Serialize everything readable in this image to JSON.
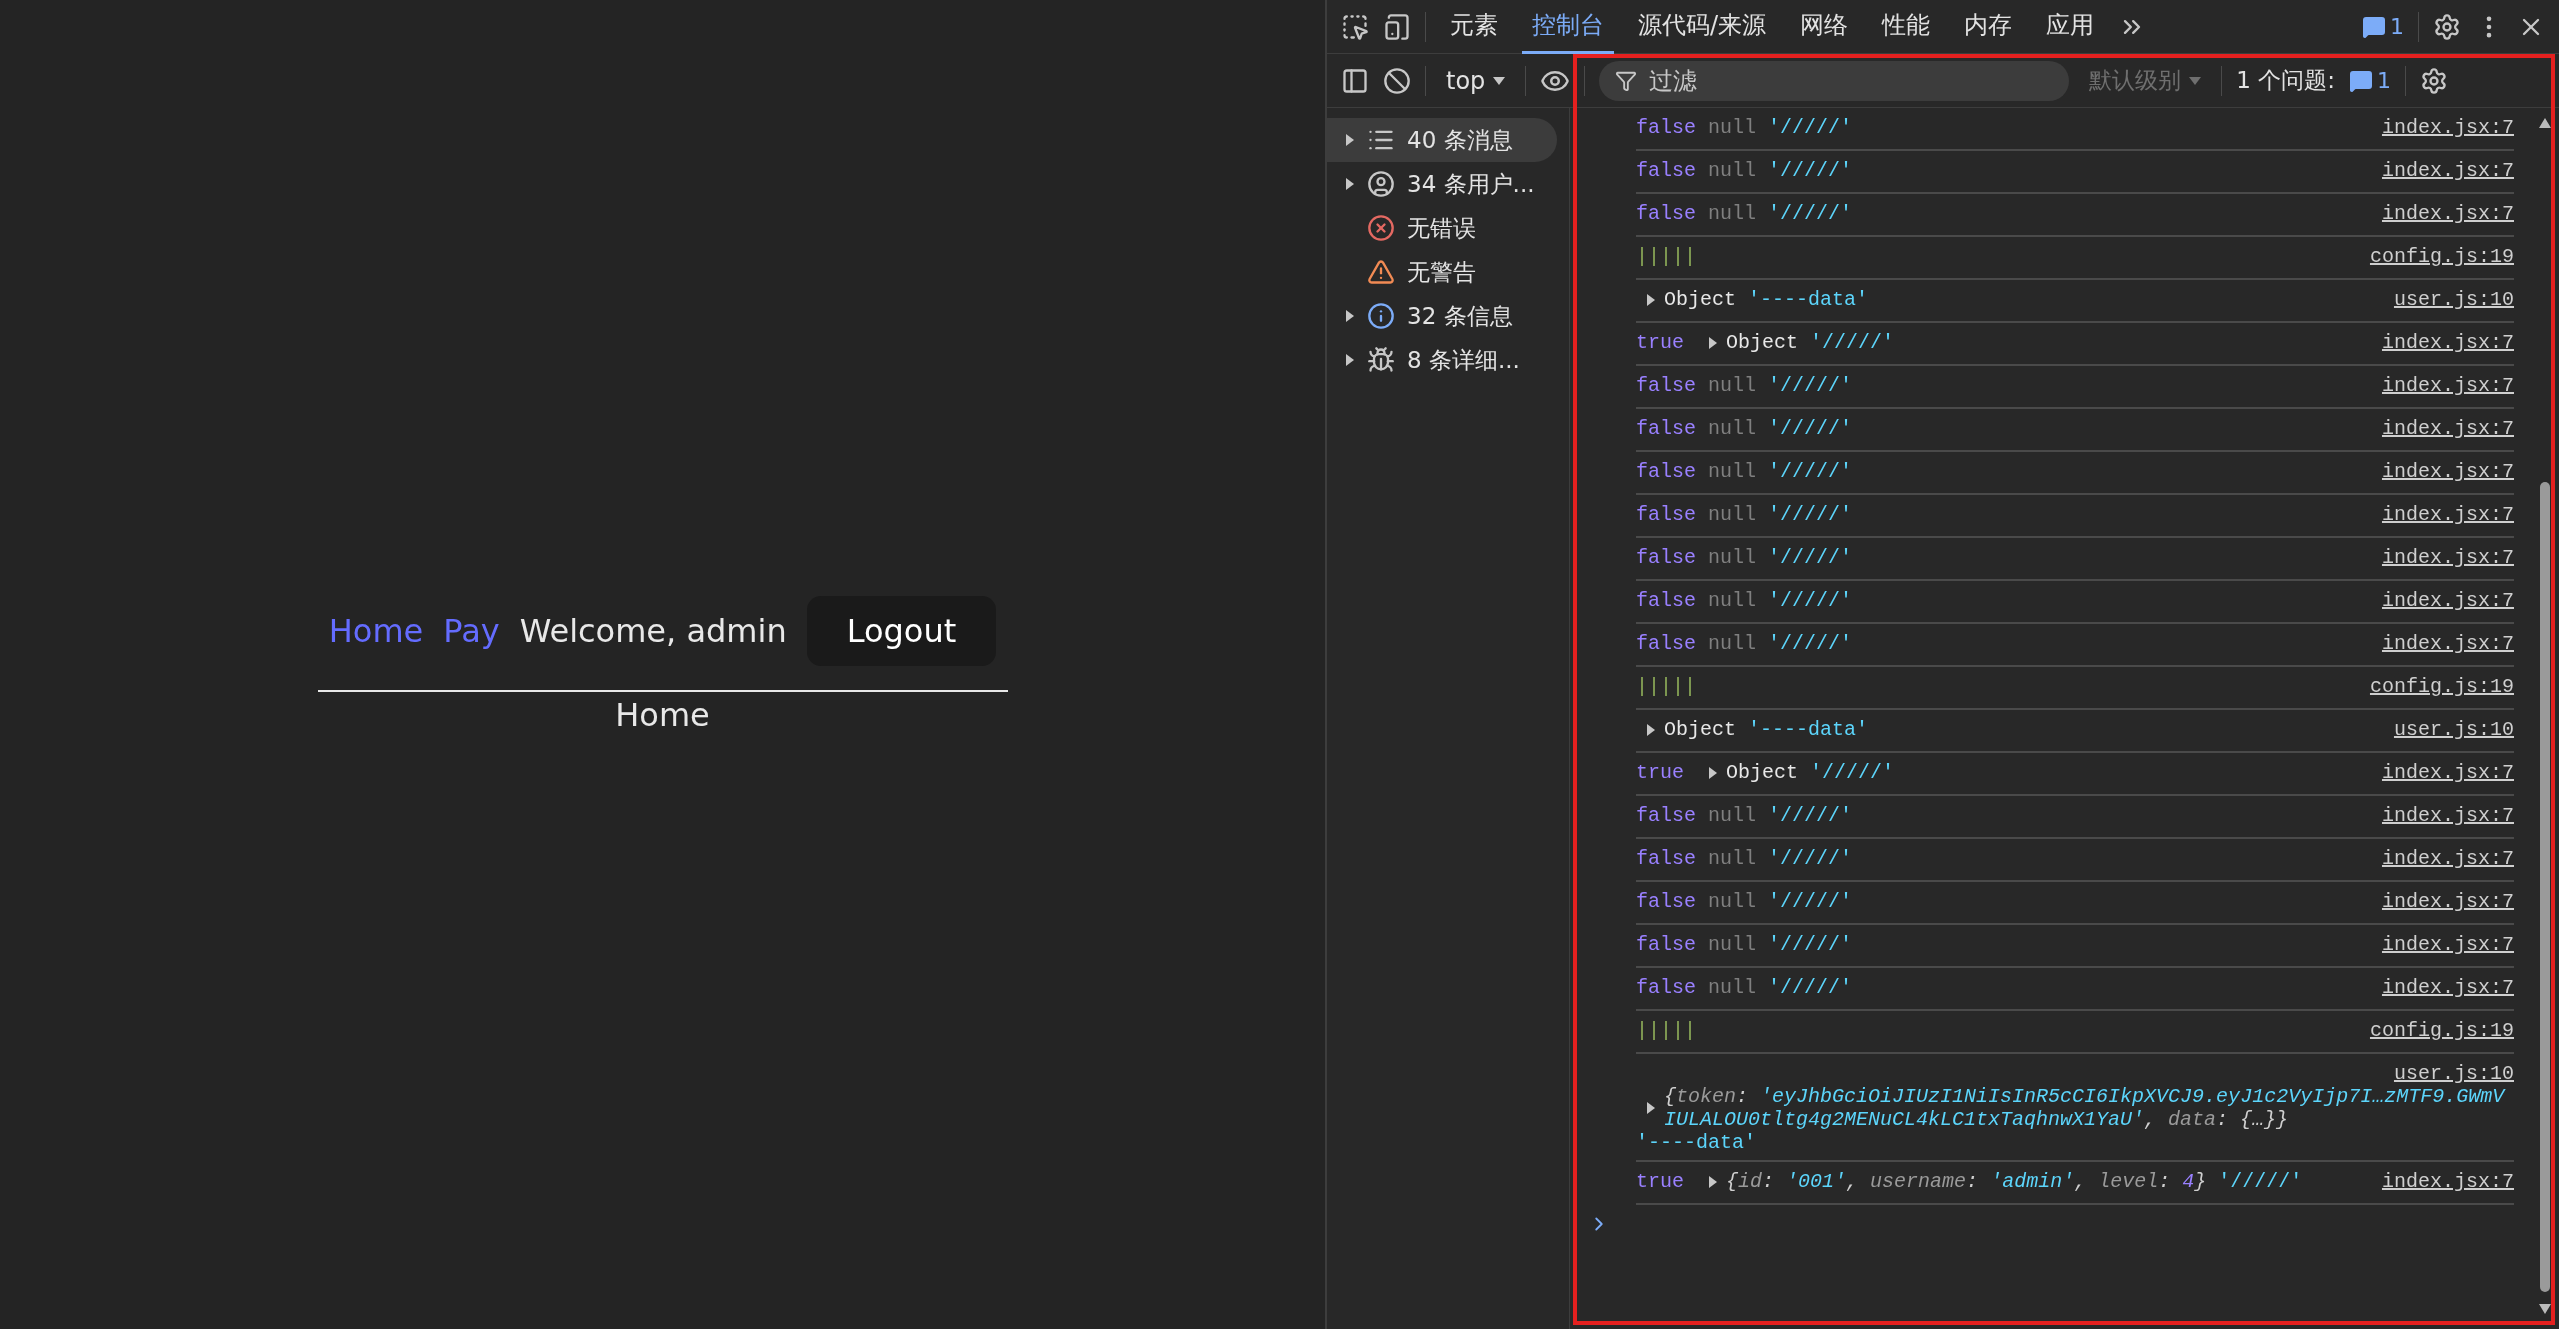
{
  "app": {
    "nav_links": [
      {
        "label": "Home"
      },
      {
        "label": "Pay"
      }
    ],
    "greeting": "Welcome, admin",
    "logout_button": "Logout",
    "page_heading": "Home"
  },
  "devtools": {
    "tabs": [
      {
        "label": "元素",
        "selected": false
      },
      {
        "label": "控制台",
        "selected": true
      },
      {
        "label": "源代码/来源",
        "selected": false
      },
      {
        "label": "网络",
        "selected": false
      },
      {
        "label": "性能",
        "selected": false
      },
      {
        "label": "内存",
        "selected": false
      },
      {
        "label": "应用",
        "selected": false
      }
    ],
    "issue_count": "1",
    "console_toolbar": {
      "context": "top",
      "filter_placeholder": "过滤",
      "level": {
        "label": "默认级别",
        "disabled": true
      },
      "issues_label": "1 个问题:",
      "issues_count": "1"
    },
    "sidebar": [
      {
        "label": "40 条消息",
        "kind": "list",
        "expandable": true,
        "selected": true
      },
      {
        "label": "34 条用户...",
        "kind": "user",
        "expandable": true,
        "selected": false
      },
      {
        "label": "无错误",
        "kind": "error",
        "expandable": false,
        "selected": false
      },
      {
        "label": "无警告",
        "kind": "warning",
        "expandable": false,
        "selected": false
      },
      {
        "label": "32 条信息",
        "kind": "info",
        "expandable": true,
        "selected": false
      },
      {
        "label": "8 条详细...",
        "kind": "verbose",
        "expandable": true,
        "selected": false
      }
    ],
    "messages": [
      {
        "kind": "inline",
        "parts": [
          {
            "kind": "boolean",
            "text": "false"
          },
          {
            "kind": "null",
            "text": "null"
          },
          {
            "kind": "string",
            "text": "'/////'"
          }
        ],
        "source": "index.jsx:7"
      },
      {
        "kind": "inline",
        "parts": [
          {
            "kind": "boolean",
            "text": "false"
          },
          {
            "kind": "null",
            "text": "null"
          },
          {
            "kind": "string",
            "text": "'/////'"
          }
        ],
        "source": "index.jsx:7"
      },
      {
        "kind": "inline",
        "parts": [
          {
            "kind": "boolean",
            "text": "false"
          },
          {
            "kind": "null",
            "text": "null"
          },
          {
            "kind": "string",
            "text": "'/////'"
          }
        ],
        "source": "index.jsx:7"
      },
      {
        "kind": "inline",
        "parts": [
          {
            "kind": "bars",
            "text": "|||||"
          }
        ],
        "source": "config.js:19"
      },
      {
        "kind": "inline",
        "parts": [
          {
            "kind": "object",
            "text": "Object"
          },
          {
            "kind": "string",
            "text": "'----data'"
          }
        ],
        "source": "user.js:10"
      },
      {
        "kind": "inline",
        "parts": [
          {
            "kind": "boolean",
            "text": "true"
          },
          {
            "kind": "object",
            "text": "Object"
          },
          {
            "kind": "string",
            "text": "'/////'"
          }
        ],
        "source": "index.jsx:7"
      },
      {
        "kind": "inline",
        "parts": [
          {
            "kind": "boolean",
            "text": "false"
          },
          {
            "kind": "null",
            "text": "null"
          },
          {
            "kind": "string",
            "text": "'/////'"
          }
        ],
        "source": "index.jsx:7"
      },
      {
        "kind": "inline",
        "parts": [
          {
            "kind": "boolean",
            "text": "false"
          },
          {
            "kind": "null",
            "text": "null"
          },
          {
            "kind": "string",
            "text": "'/////'"
          }
        ],
        "source": "index.jsx:7"
      },
      {
        "kind": "inline",
        "parts": [
          {
            "kind": "boolean",
            "text": "false"
          },
          {
            "kind": "null",
            "text": "null"
          },
          {
            "kind": "string",
            "text": "'/////'"
          }
        ],
        "source": "index.jsx:7"
      },
      {
        "kind": "inline",
        "parts": [
          {
            "kind": "boolean",
            "text": "false"
          },
          {
            "kind": "null",
            "text": "null"
          },
          {
            "kind": "string",
            "text": "'/////'"
          }
        ],
        "source": "index.jsx:7"
      },
      {
        "kind": "inline",
        "parts": [
          {
            "kind": "boolean",
            "text": "false"
          },
          {
            "kind": "null",
            "text": "null"
          },
          {
            "kind": "string",
            "text": "'/////'"
          }
        ],
        "source": "index.jsx:7"
      },
      {
        "kind": "inline",
        "parts": [
          {
            "kind": "boolean",
            "text": "false"
          },
          {
            "kind": "null",
            "text": "null"
          },
          {
            "kind": "string",
            "text": "'/////'"
          }
        ],
        "source": "index.jsx:7"
      },
      {
        "kind": "inline",
        "parts": [
          {
            "kind": "boolean",
            "text": "false"
          },
          {
            "kind": "null",
            "text": "null"
          },
          {
            "kind": "string",
            "text": "'/////'"
          }
        ],
        "source": "index.jsx:7"
      },
      {
        "kind": "inline",
        "parts": [
          {
            "kind": "bars",
            "text": "|||||"
          }
        ],
        "source": "config.js:19"
      },
      {
        "kind": "inline",
        "parts": [
          {
            "kind": "object",
            "text": "Object"
          },
          {
            "kind": "string",
            "text": "'----data'"
          }
        ],
        "source": "user.js:10"
      },
      {
        "kind": "inline",
        "parts": [
          {
            "kind": "boolean",
            "text": "true"
          },
          {
            "kind": "object",
            "text": "Object"
          },
          {
            "kind": "string",
            "text": "'/////'"
          }
        ],
        "source": "index.jsx:7"
      },
      {
        "kind": "inline",
        "parts": [
          {
            "kind": "boolean",
            "text": "false"
          },
          {
            "kind": "null",
            "text": "null"
          },
          {
            "kind": "string",
            "text": "'/////'"
          }
        ],
        "source": "index.jsx:7"
      },
      {
        "kind": "inline",
        "parts": [
          {
            "kind": "boolean",
            "text": "false"
          },
          {
            "kind": "null",
            "text": "null"
          },
          {
            "kind": "string",
            "text": "'/////'"
          }
        ],
        "source": "index.jsx:7"
      },
      {
        "kind": "inline",
        "parts": [
          {
            "kind": "boolean",
            "text": "false"
          },
          {
            "kind": "null",
            "text": "null"
          },
          {
            "kind": "string",
            "text": "'/////'"
          }
        ],
        "source": "index.jsx:7"
      },
      {
        "kind": "inline",
        "parts": [
          {
            "kind": "boolean",
            "text": "false"
          },
          {
            "kind": "null",
            "text": "null"
          },
          {
            "kind": "string",
            "text": "'/////'"
          }
        ],
        "source": "index.jsx:7"
      },
      {
        "kind": "inline",
        "parts": [
          {
            "kind": "boolean",
            "text": "false"
          },
          {
            "kind": "null",
            "text": "null"
          },
          {
            "kind": "string",
            "text": "'/////'"
          }
        ],
        "source": "index.jsx:7"
      },
      {
        "kind": "inline",
        "parts": [
          {
            "kind": "bars",
            "text": "|||||"
          }
        ],
        "source": "config.js:19"
      },
      {
        "kind": "stacked",
        "parts": [
          {
            "kind": "preview",
            "segments": [
              {
                "kind": "punct",
                "text": "{"
              },
              {
                "kind": "key",
                "text": "token"
              },
              {
                "kind": "punct",
                "text": ": "
              },
              {
                "kind": "string",
                "text": "'eyJhbGciOiJIUzI1NiIsInR5cCI6IkpXVCJ9.eyJ1c2VyIjp7I…zMTF9.GWmVIULALOU0tltg4g2MENuCL4kLC1txTaqhnwX1YaU'"
              },
              {
                "kind": "punct",
                "text": ", "
              },
              {
                "kind": "key",
                "text": "data"
              },
              {
                "kind": "punct",
                "text": ": {…}}"
              }
            ]
          },
          {
            "kind": "string",
            "text": "'----data'"
          }
        ],
        "source": "user.js:10"
      },
      {
        "kind": "inline",
        "parts": [
          {
            "kind": "boolean",
            "text": "true"
          },
          {
            "kind": "preview",
            "segments": [
              {
                "kind": "punct",
                "text": "{"
              },
              {
                "kind": "key",
                "text": "id"
              },
              {
                "kind": "punct",
                "text": ": "
              },
              {
                "kind": "string",
                "text": "'001'"
              },
              {
                "kind": "punct",
                "text": ", "
              },
              {
                "kind": "key",
                "text": "username"
              },
              {
                "kind": "punct",
                "text": ": "
              },
              {
                "kind": "string",
                "text": "'admin'"
              },
              {
                "kind": "punct",
                "text": ", "
              },
              {
                "kind": "key",
                "text": "level"
              },
              {
                "kind": "punct",
                "text": ": "
              },
              {
                "kind": "number",
                "text": "4"
              },
              {
                "kind": "punct",
                "text": "}"
              }
            ]
          },
          {
            "kind": "string",
            "text": "'/////'"
          }
        ],
        "source": "index.jsx:7"
      }
    ]
  }
}
